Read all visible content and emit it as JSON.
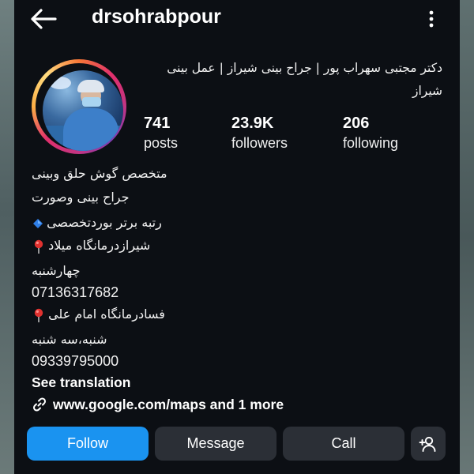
{
  "header": {
    "username": "drsohrabpour"
  },
  "profile": {
    "title_line_1": "دکتر مجتبی سهراب پور | جراح بینی شیراز | عمل بینی",
    "title_line_2": "شیراز",
    "stats": [
      {
        "value": "741",
        "label": "posts"
      },
      {
        "value": "23.9K",
        "label": "followers"
      },
      {
        "value": "206",
        "label": "following"
      }
    ]
  },
  "bio": {
    "line_1": "متخصص گوش حلق وبینی",
    "line_2": "جراح بینی وصورت",
    "line_3": "رتبه برتر بوردتخصصی",
    "line_4": "شیرازدرمانگاه میلاد",
    "line_5": "چهارشنبه",
    "line_6": "07136317682",
    "line_7": "فسادرمانگاه امام علی",
    "line_8": "شنبه،سه شنبه",
    "line_9": "09339795000",
    "see_translation": "See translation",
    "link": "www.google.com/maps and 1 more"
  },
  "actions": {
    "follow": "Follow",
    "message": "Message",
    "call": "Call"
  },
  "colors": {
    "background": "#0c0f14",
    "follow_button": "#1a93f0",
    "secondary_button": "#2b2f36",
    "pin": "#e0312f",
    "diamond": "#2f7fe8"
  },
  "icons": [
    "back-arrow-icon",
    "more-vertical-icon",
    "pin-icon",
    "diamond-icon",
    "link-icon",
    "add-user-icon"
  ]
}
